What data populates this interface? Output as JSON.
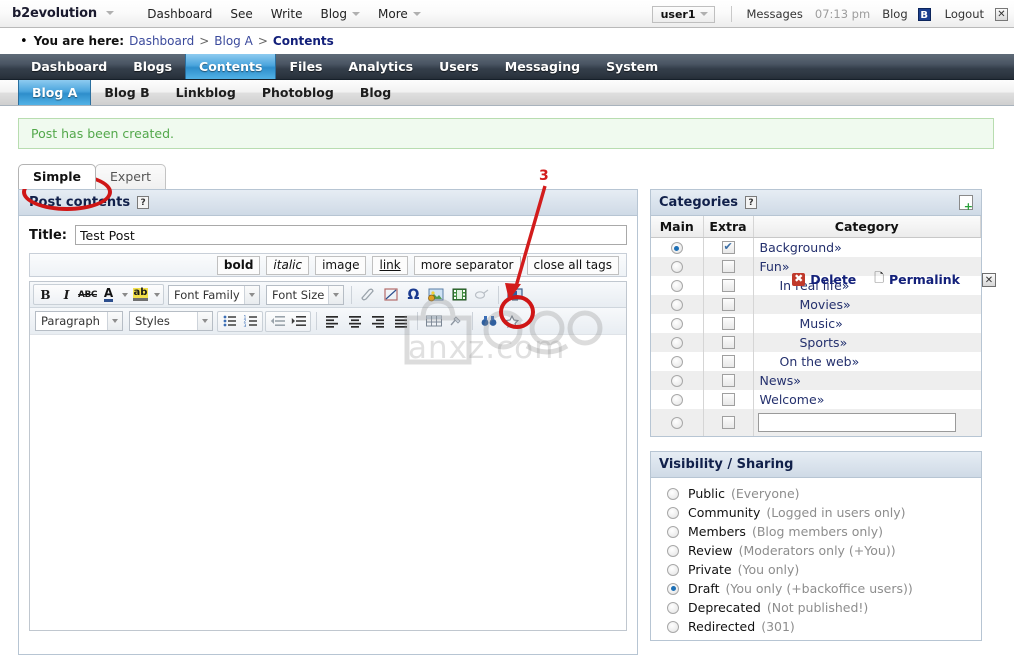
{
  "topbar": {
    "brand": "b2evolution",
    "menu": [
      {
        "label": "Dashboard",
        "has_caret": false
      },
      {
        "label": "See",
        "has_caret": false
      },
      {
        "label": "Write",
        "has_caret": false
      },
      {
        "label": "Blog",
        "has_caret": true
      },
      {
        "label": "More",
        "has_caret": true
      }
    ],
    "user": "user1",
    "messages_label": "Messages",
    "clock": "07:13 pm",
    "blog_label": "Blog",
    "blog_badge": "B",
    "logout_label": "Logout",
    "logout_icon": "close-x-icon"
  },
  "breadcrumb": {
    "prefix": "You are here:",
    "items": [
      "Dashboard",
      "Blog A"
    ],
    "current": "Contents",
    "separator": ">"
  },
  "mainnav": {
    "items": [
      "Dashboard",
      "Blogs",
      "Contents",
      "Files",
      "Analytics",
      "Users",
      "Messaging",
      "System"
    ],
    "active": "Contents"
  },
  "subnav": {
    "items": [
      "Blog A",
      "Blog B",
      "Linkblog",
      "Photoblog",
      "Blog"
    ],
    "active": "Blog A"
  },
  "message": {
    "text": "Post has been created.",
    "color": "#53a84b"
  },
  "tabs": {
    "items": [
      "Simple",
      "Expert"
    ],
    "active": "Simple"
  },
  "actions": {
    "delete_label": "Delete",
    "permalink_label": "Permalink",
    "close_label": "x"
  },
  "post_panel": {
    "header": "Post contents",
    "help_icon": "help-icon",
    "title_label": "Title:",
    "title_value": "Test Post",
    "title_placeholder": ""
  },
  "quicktags": [
    {
      "label": "bold",
      "style": "bold"
    },
    {
      "label": "italic",
      "style": "italic"
    },
    {
      "label": "image",
      "style": "normal"
    },
    {
      "label": "link",
      "style": "underline"
    },
    {
      "label": "more separator",
      "style": "normal"
    },
    {
      "label": "close all tags",
      "style": "normal"
    }
  ],
  "editor_toolbar": {
    "row1": {
      "bold": "B",
      "italic": "I",
      "strikethrough": "ABC",
      "forecolor": "A",
      "backcolor": "ab",
      "font_family": "Font Family",
      "font_size": "Font Size"
    },
    "row2": {
      "format": "Paragraph",
      "styles": "Styles"
    },
    "icon_names": [
      "eraser-icon",
      "remove-formatting-icon",
      "omega-special-char-icon",
      "insert-image-icon",
      "insert-media-icon",
      "anchor-icon",
      "insert-screen-icon",
      "insert-table-icon",
      "binoculars-spellcheck-icon",
      "cleanup-icon",
      "bullet-list-icon",
      "numbered-list-icon",
      "outdent-icon",
      "indent-icon",
      "align-left-icon",
      "align-center-icon",
      "align-right-icon",
      "align-justify-icon"
    ]
  },
  "categories": {
    "header": "Categories",
    "help_icon": "help-icon",
    "new_icon": "new-category-icon",
    "columns": [
      "Main",
      "Extra",
      "Category"
    ],
    "rows": [
      {
        "name": "Background",
        "indent": 0,
        "main": true,
        "extra": true
      },
      {
        "name": "Fun",
        "indent": 0,
        "main": false,
        "extra": false
      },
      {
        "name": "In real life",
        "indent": 1,
        "main": false,
        "extra": false
      },
      {
        "name": "Movies",
        "indent": 2,
        "main": false,
        "extra": false
      },
      {
        "name": "Music",
        "indent": 2,
        "main": false,
        "extra": false
      },
      {
        "name": "Sports",
        "indent": 2,
        "main": false,
        "extra": false
      },
      {
        "name": "On the web",
        "indent": 1,
        "main": false,
        "extra": false
      },
      {
        "name": "News",
        "indent": 0,
        "main": false,
        "extra": false
      },
      {
        "name": "Welcome",
        "indent": 0,
        "main": false,
        "extra": false
      }
    ],
    "arrow": "»",
    "new_input_value": "",
    "new_input_placeholder": ""
  },
  "visibility": {
    "header": "Visibility / Sharing",
    "options": [
      {
        "name": "Public",
        "desc": "(Everyone)",
        "selected": false
      },
      {
        "name": "Community",
        "desc": "(Logged in users only)",
        "selected": false
      },
      {
        "name": "Members",
        "desc": "(Blog members only)",
        "selected": false
      },
      {
        "name": "Review",
        "desc": "(Moderators only (+You))",
        "selected": false
      },
      {
        "name": "Private",
        "desc": "(You only)",
        "selected": false
      },
      {
        "name": "Draft",
        "desc": "(You only (+backoffice users))",
        "selected": true
      },
      {
        "name": "Deprecated",
        "desc": "(Not published!)",
        "selected": false
      },
      {
        "name": "Redirected",
        "desc": "(301)",
        "selected": false
      }
    ]
  },
  "annotations": {
    "step_number": "3",
    "color": "#d21c1c",
    "ellipse_targets": [
      "simple-tab",
      "insert-media-toolbar-button"
    ]
  },
  "watermark": {
    "text": "anxz.com",
    "logo": "bag-logo"
  }
}
